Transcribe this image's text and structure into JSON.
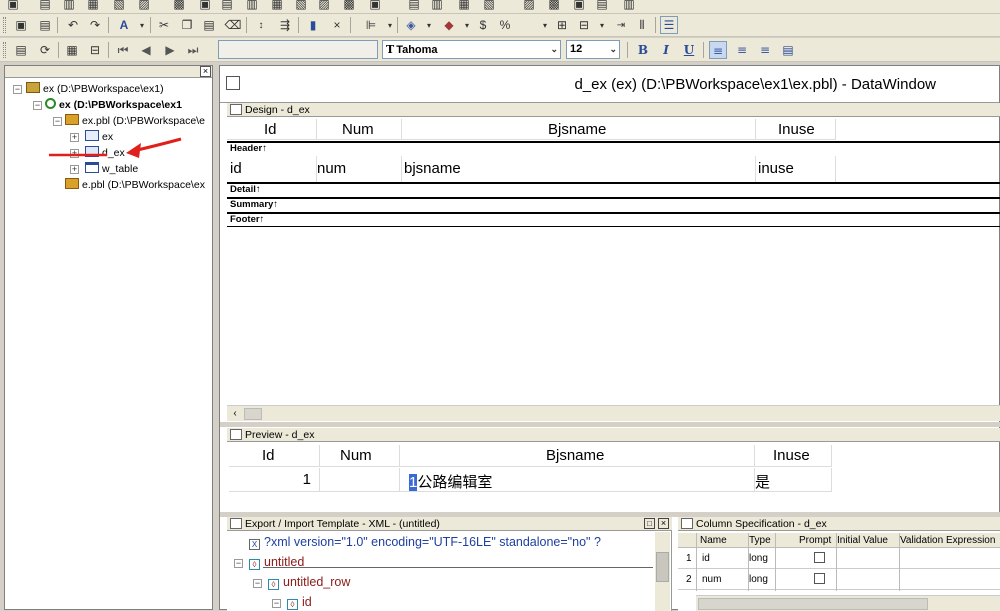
{
  "toolbar": {
    "font_name": "Tahoma",
    "font_size": "12",
    "bold": "B",
    "italic": "I",
    "underline": "U",
    "currency": "$",
    "percent": "%",
    "close": "×"
  },
  "tree": {
    "items": [
      {
        "label": "ex (D:\\PBWorkspace\\ex1)"
      },
      {
        "label": "ex (D:\\PBWorkspace\\ex1"
      },
      {
        "label": "ex.pbl (D:\\PBWorkspace\\e"
      },
      {
        "label": "ex"
      },
      {
        "label": "d_ex"
      },
      {
        "label": "w_table"
      },
      {
        "label": "e.pbl (D:\\PBWorkspace\\ex"
      }
    ]
  },
  "datawindow": {
    "title": "d_ex  (ex) (D:\\PBWorkspace\\ex1\\ex.pbl) - DataWindow",
    "design": {
      "title": "Design - d_ex",
      "headers": [
        "Id",
        "Num",
        "Bjsname",
        "Inuse"
      ],
      "fields": [
        "id",
        "num",
        "bjsname",
        "inuse"
      ],
      "bands": [
        "Header↑",
        "Detail↑",
        "Summary↑",
        "Footer↑"
      ]
    },
    "preview": {
      "title": "Preview - d_ex",
      "headers": [
        "Id",
        "Num",
        "Bjsname",
        "Inuse"
      ],
      "row": {
        "id": "1",
        "num": "",
        "bjsname_cursor": "1",
        "bjsname": "公路编辑室",
        "inuse": "是"
      }
    },
    "export": {
      "title": "Export / Import Template - XML - (untitled)",
      "lines": [
        "?xml version=\"1.0\" encoding=\"UTF-16LE\" standalone=\"no\" ?",
        "untitled",
        "untitled_row",
        "id"
      ]
    },
    "colspec": {
      "title": "Column Specification - d_ex",
      "headers": [
        "Name",
        "Type",
        "Prompt",
        "Initial Value",
        "Validation Expression"
      ],
      "rows": [
        {
          "n": "1",
          "name": "id",
          "type": "long"
        },
        {
          "n": "2",
          "name": "num",
          "type": "long"
        }
      ]
    }
  },
  "colors": {
    "xml_node": "#8b1a1a",
    "xml_pi": "#1f3fa0",
    "annotation": "#e0201a"
  }
}
